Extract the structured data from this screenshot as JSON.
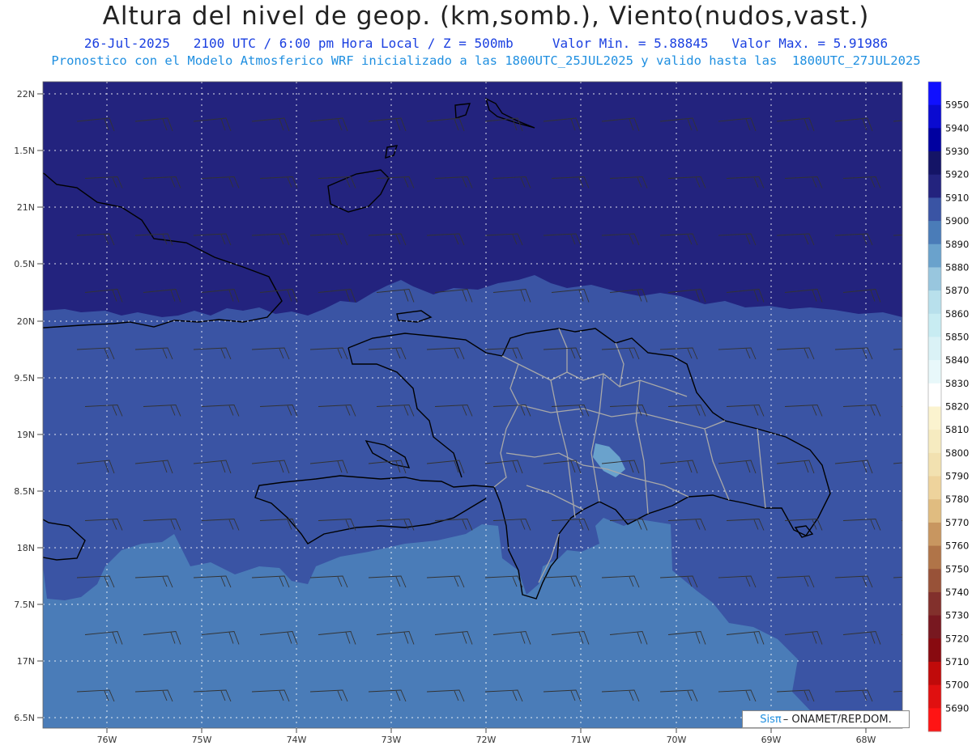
{
  "header": {
    "title": "Altura del nivel de geop. (km,somb.), Viento(nudos,vast.)",
    "line1": "26-Jul-2025   2100 UTC / 6:00 pm Hora Local / Z = 500mb     Valor Min. = 5.88845   Valor Max. = 5.91986",
    "line2": "Pronostico con el Modelo Atmosferico WRF inicializado a las 1800UTC_25JUL2025 y valido hasta las  1800UTC_27JUL2025"
  },
  "axes": {
    "y_labels": [
      "22N",
      "1.5N",
      "21N",
      "0.5N",
      "20N",
      "9.5N",
      "19N",
      "8.5N",
      "18N",
      "7.5N",
      "17N",
      "6.5N"
    ],
    "x_labels": [
      "76W",
      "75W",
      "74W",
      "73W",
      "72W",
      "71W",
      "70W",
      "69W",
      "68W"
    ]
  },
  "colorbar": {
    "levels": [
      "5950",
      "5940",
      "5930",
      "5920",
      "5910",
      "5900",
      "5890",
      "5880",
      "5870",
      "5860",
      "5850",
      "5840",
      "5830",
      "5820",
      "5810",
      "5800",
      "5790",
      "5780",
      "5770",
      "5760",
      "5750",
      "5740",
      "5730",
      "5720",
      "5710",
      "5700",
      "5690"
    ],
    "colors": [
      "#1010ff",
      "#0a0ad0",
      "#0000a0",
      "#141466",
      "#23237e",
      "#3a54a4",
      "#4a7cb8",
      "#6aa2cc",
      "#98c6de",
      "#b8e0ec",
      "#c8ecf2",
      "#daf2f6",
      "#e8f8fa",
      "#ffffff",
      "#fbf3cf",
      "#f6ebc0",
      "#f2e1b0",
      "#eed39c",
      "#e0bc80",
      "#c89660",
      "#b07448",
      "#985238",
      "#82302c",
      "#781820",
      "#880a10",
      "#c00a0a",
      "#e01010",
      "#ff1414"
    ]
  },
  "legend_colors": {
    "band_5910": "#23237e",
    "band_5900": "#3a54a4",
    "band_5890": "#4a7cb8",
    "band_5880": "#6aa2cc"
  },
  "credit": {
    "sis": "Sisπ",
    "text": "– ONAMET/REP.DOM."
  }
}
